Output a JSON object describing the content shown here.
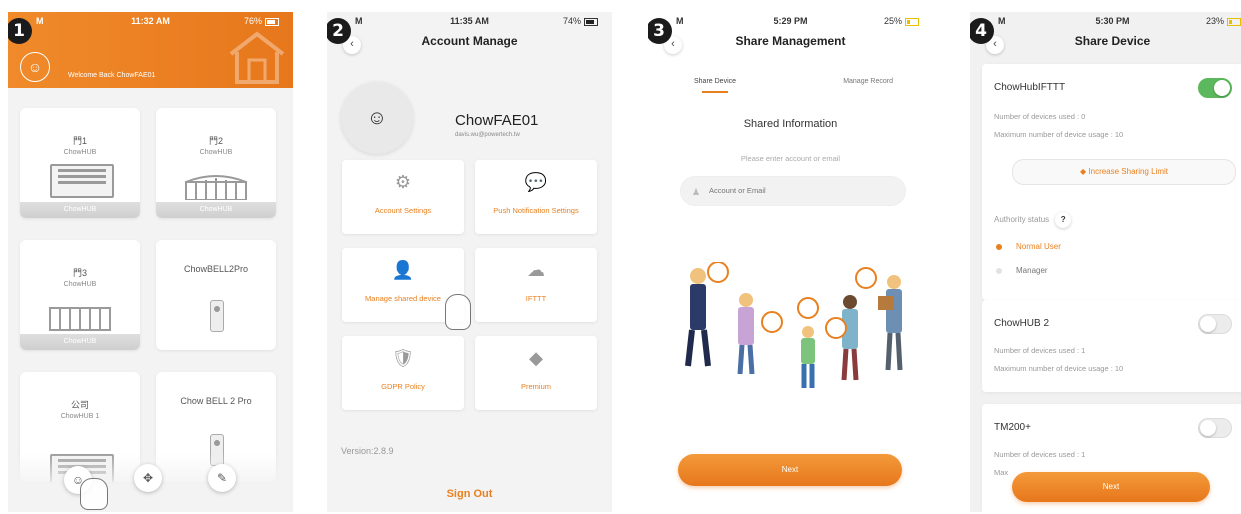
{
  "steps": [
    "1",
    "2",
    "3",
    "4"
  ],
  "screen1": {
    "status": {
      "left": "M",
      "time": "11:32 AM",
      "battery": "76%"
    },
    "welcome": "Welcome Back ChowFAE01",
    "tiles": [
      {
        "name": "門1",
        "sub": "ChowHUB",
        "band": "ChowHUB"
      },
      {
        "name": "門2",
        "sub": "ChowHUB",
        "band": "ChowHUB"
      },
      {
        "name": "門3",
        "sub": "ChowHUB",
        "band": "ChowHUB"
      },
      {
        "name": "ChowBELL2Pro"
      },
      {
        "name": "公司",
        "sub": "ChowHUB 1"
      },
      {
        "name": "Chow BELL 2 Pro"
      }
    ],
    "fab_icons": [
      "user-icon",
      "move-icon",
      "edit-icon"
    ]
  },
  "screen2": {
    "status": {
      "left": "M",
      "time": "11:35 AM",
      "battery": "74%"
    },
    "title": "Account Manage",
    "back": "‹",
    "username": "ChowFAE01",
    "email": "davis.wu@powertech.tw",
    "menu": [
      {
        "label": "Account Settings",
        "icon": "⚙"
      },
      {
        "label": "Push Notification Settings",
        "icon": "💬"
      },
      {
        "label": "Manage shared device",
        "icon": "👤"
      },
      {
        "label": "IFTTT",
        "icon": "☁"
      },
      {
        "label": "GDPR Policy",
        "icon": "🛡"
      },
      {
        "label": "Premium",
        "icon": "◆"
      }
    ],
    "version": "Version:2.8.9",
    "signout": "Sign Out"
  },
  "screen3": {
    "status": {
      "left": "M",
      "time": "5:29 PM",
      "battery": "25%"
    },
    "title": "Share Management",
    "back": "‹",
    "tab_share": "Share Device",
    "tab_record": "Manage Record",
    "heading": "Shared Information",
    "hint": "Please enter account or email",
    "input_placeholder": "Account or Email",
    "next": "Next"
  },
  "screen4": {
    "status": {
      "left": "M",
      "time": "5:30 PM",
      "battery": "23%"
    },
    "title": "Share Device",
    "back": "‹",
    "devices": [
      {
        "name": "ChowHubIFTTT",
        "used": "Number of devices used : 0",
        "max": "Maximum number of device usage : 10",
        "enabled": true
      },
      {
        "name": "ChowHUB 2",
        "used": "Number of devices used : 1",
        "max": "Maximum number of device usage : 10",
        "enabled": false
      },
      {
        "name": "TM200+",
        "used": "Number of devices used : 1",
        "max": "Max",
        "enabled": false
      }
    ],
    "increase_label": "Increase Sharing Limit",
    "authority_label": "Authority status",
    "help": "?",
    "role_normal": "Normal User",
    "role_manager": "Manager",
    "next": "Next",
    "accent": "#e9801f",
    "toggle_on_color": "#5cb85c"
  }
}
